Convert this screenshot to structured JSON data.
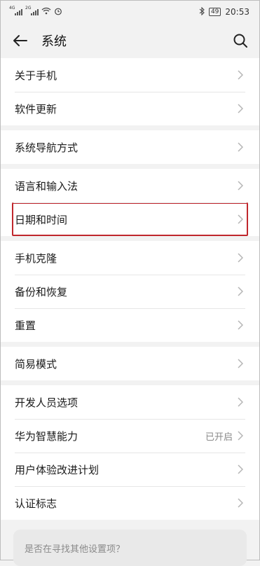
{
  "statusbar": {
    "sim1_tag": "4G",
    "sim2_tag": "2G",
    "battery": "49",
    "time": "20:53"
  },
  "header": {
    "title": "系统"
  },
  "groups": [
    {
      "items": [
        {
          "label": "关于手机"
        },
        {
          "label": "软件更新"
        }
      ]
    },
    {
      "items": [
        {
          "label": "系统导航方式"
        }
      ]
    },
    {
      "items": [
        {
          "label": "语言和输入法"
        },
        {
          "label": "日期和时间"
        }
      ]
    },
    {
      "items": [
        {
          "label": "手机克隆"
        },
        {
          "label": "备份和恢复"
        },
        {
          "label": "重置"
        }
      ]
    },
    {
      "items": [
        {
          "label": "简易模式"
        }
      ]
    },
    {
      "items": [
        {
          "label": "开发人员选项"
        },
        {
          "label": "华为智慧能力",
          "value": "已开启"
        },
        {
          "label": "用户体验改进计划"
        },
        {
          "label": "认证标志"
        }
      ]
    }
  ],
  "hint": "是否在寻找其他设置项？"
}
